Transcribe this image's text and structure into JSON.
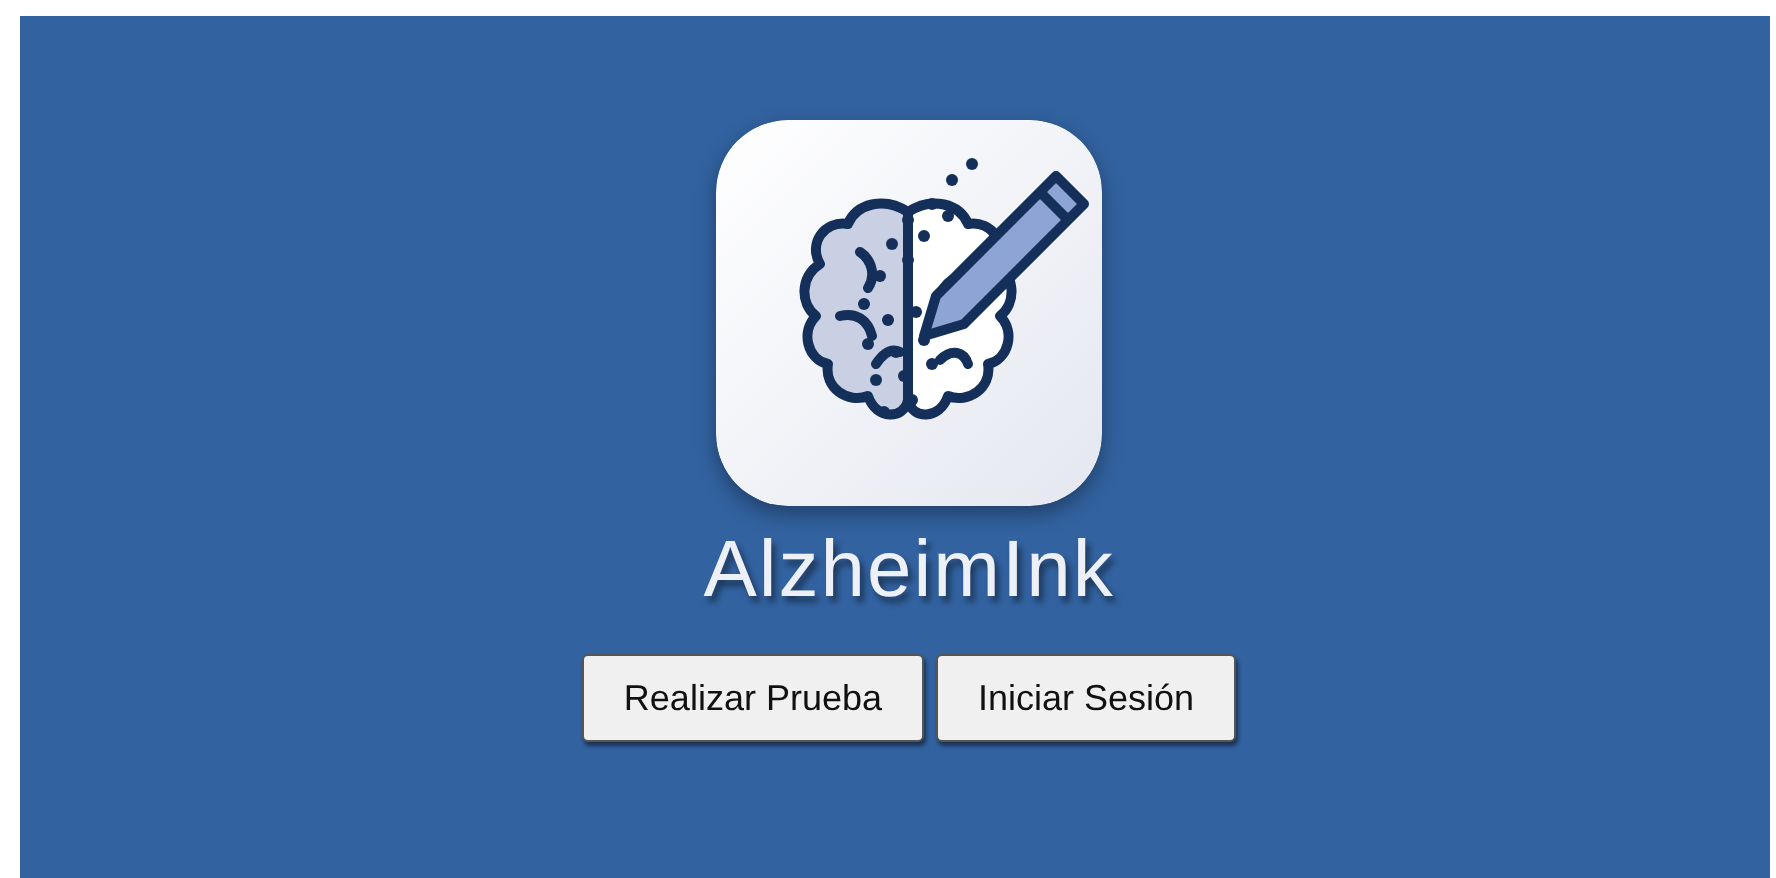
{
  "app": {
    "title": "AlzheimInk"
  },
  "buttons": [
    {
      "label": "Realizar Prueba"
    },
    {
      "label": "Iniciar Sesión"
    }
  ]
}
